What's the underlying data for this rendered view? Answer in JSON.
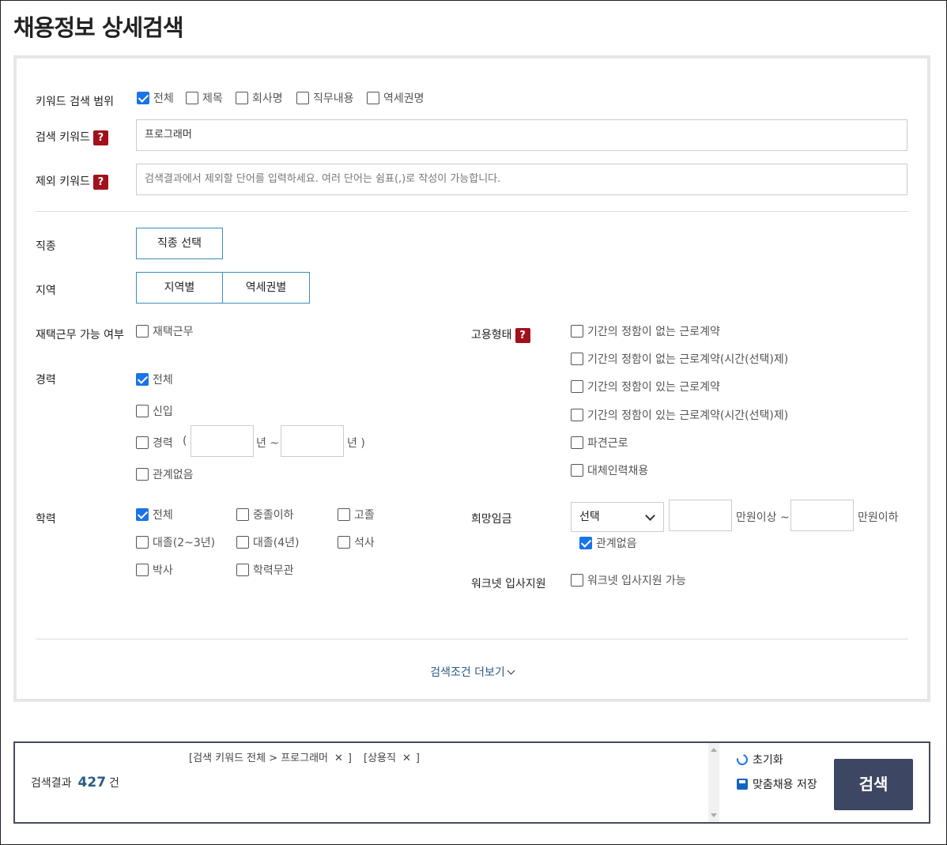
{
  "title": "채용정보 상세검색",
  "keyword_scope": {
    "label": "키워드 검색 범위",
    "options": [
      {
        "label": "전체",
        "checked": true
      },
      {
        "label": "제목",
        "checked": false
      },
      {
        "label": "회사명",
        "checked": false
      },
      {
        "label": "직무내용",
        "checked": false
      },
      {
        "label": "역세권명",
        "checked": false
      }
    ]
  },
  "search_keyword": {
    "label": "검색 키워드",
    "value": "프로그래머"
  },
  "exclude_keyword": {
    "label": "제외 키워드",
    "placeholder": "검색결과에서 제외할 단어를 입력하세요. 여러 단어는 쉼표(,)로 작성이 가능합니다."
  },
  "help_glyph": "?",
  "job_type": {
    "label": "직종",
    "button": "직종 선택"
  },
  "region": {
    "label": "지역",
    "buttons": [
      "지역별",
      "역세권별"
    ]
  },
  "remote": {
    "label": "재택근무 가능 여부",
    "option": "재택근무",
    "checked": false
  },
  "career": {
    "label": "경력",
    "options": [
      {
        "label": "전체",
        "checked": true
      },
      {
        "label": "신입",
        "checked": false
      },
      {
        "label": "경력",
        "checked": false
      },
      {
        "label": "관계없음",
        "checked": false
      }
    ],
    "range_open": "(",
    "unit_from": "년 ~",
    "unit_to": "년 )"
  },
  "employment": {
    "label": "고용형태",
    "options": [
      {
        "label": "기간의 정함이 없는 근로계약",
        "checked": false
      },
      {
        "label": "기간의 정함이 없는 근로계약(시간(선택)제)",
        "checked": false
      },
      {
        "label": "기간의 정함이 있는 근로계약",
        "checked": false
      },
      {
        "label": "기간의 정함이 있는 근로계약(시간(선택)제)",
        "checked": false
      },
      {
        "label": "파견근로",
        "checked": false
      },
      {
        "label": "대체인력채용",
        "checked": false
      }
    ]
  },
  "education": {
    "label": "학력",
    "options": [
      {
        "label": "전체",
        "checked": true
      },
      {
        "label": "중졸이하",
        "checked": false
      },
      {
        "label": "고졸",
        "checked": false
      },
      {
        "label": "대졸(2~3년)",
        "checked": false
      },
      {
        "label": "대졸(4년)",
        "checked": false
      },
      {
        "label": "석사",
        "checked": false
      },
      {
        "label": "박사",
        "checked": false
      },
      {
        "label": "학력무관",
        "checked": false
      }
    ]
  },
  "salary": {
    "label": "희망임금",
    "select": "선택",
    "unit_min": "만원이상 ~",
    "unit_max": "만원이하",
    "any_label": "관계없음",
    "any_checked": true
  },
  "worknet": {
    "label": "워크넷 입사지원",
    "option": "워크넷 입사지원 가능",
    "checked": false
  },
  "more_link": "검색조건 더보기",
  "result": {
    "tags": [
      {
        "text": "[검색 키워드 전체 > 프로그래머",
        "close": "✕",
        "end": "]"
      },
      {
        "text": "[상용직",
        "close": "✕",
        "end": "]"
      }
    ],
    "count_label": "검색결과",
    "count": "427",
    "count_unit": "건",
    "reset": "초기화",
    "save": "맞춤채용 저장",
    "search": "검색"
  }
}
